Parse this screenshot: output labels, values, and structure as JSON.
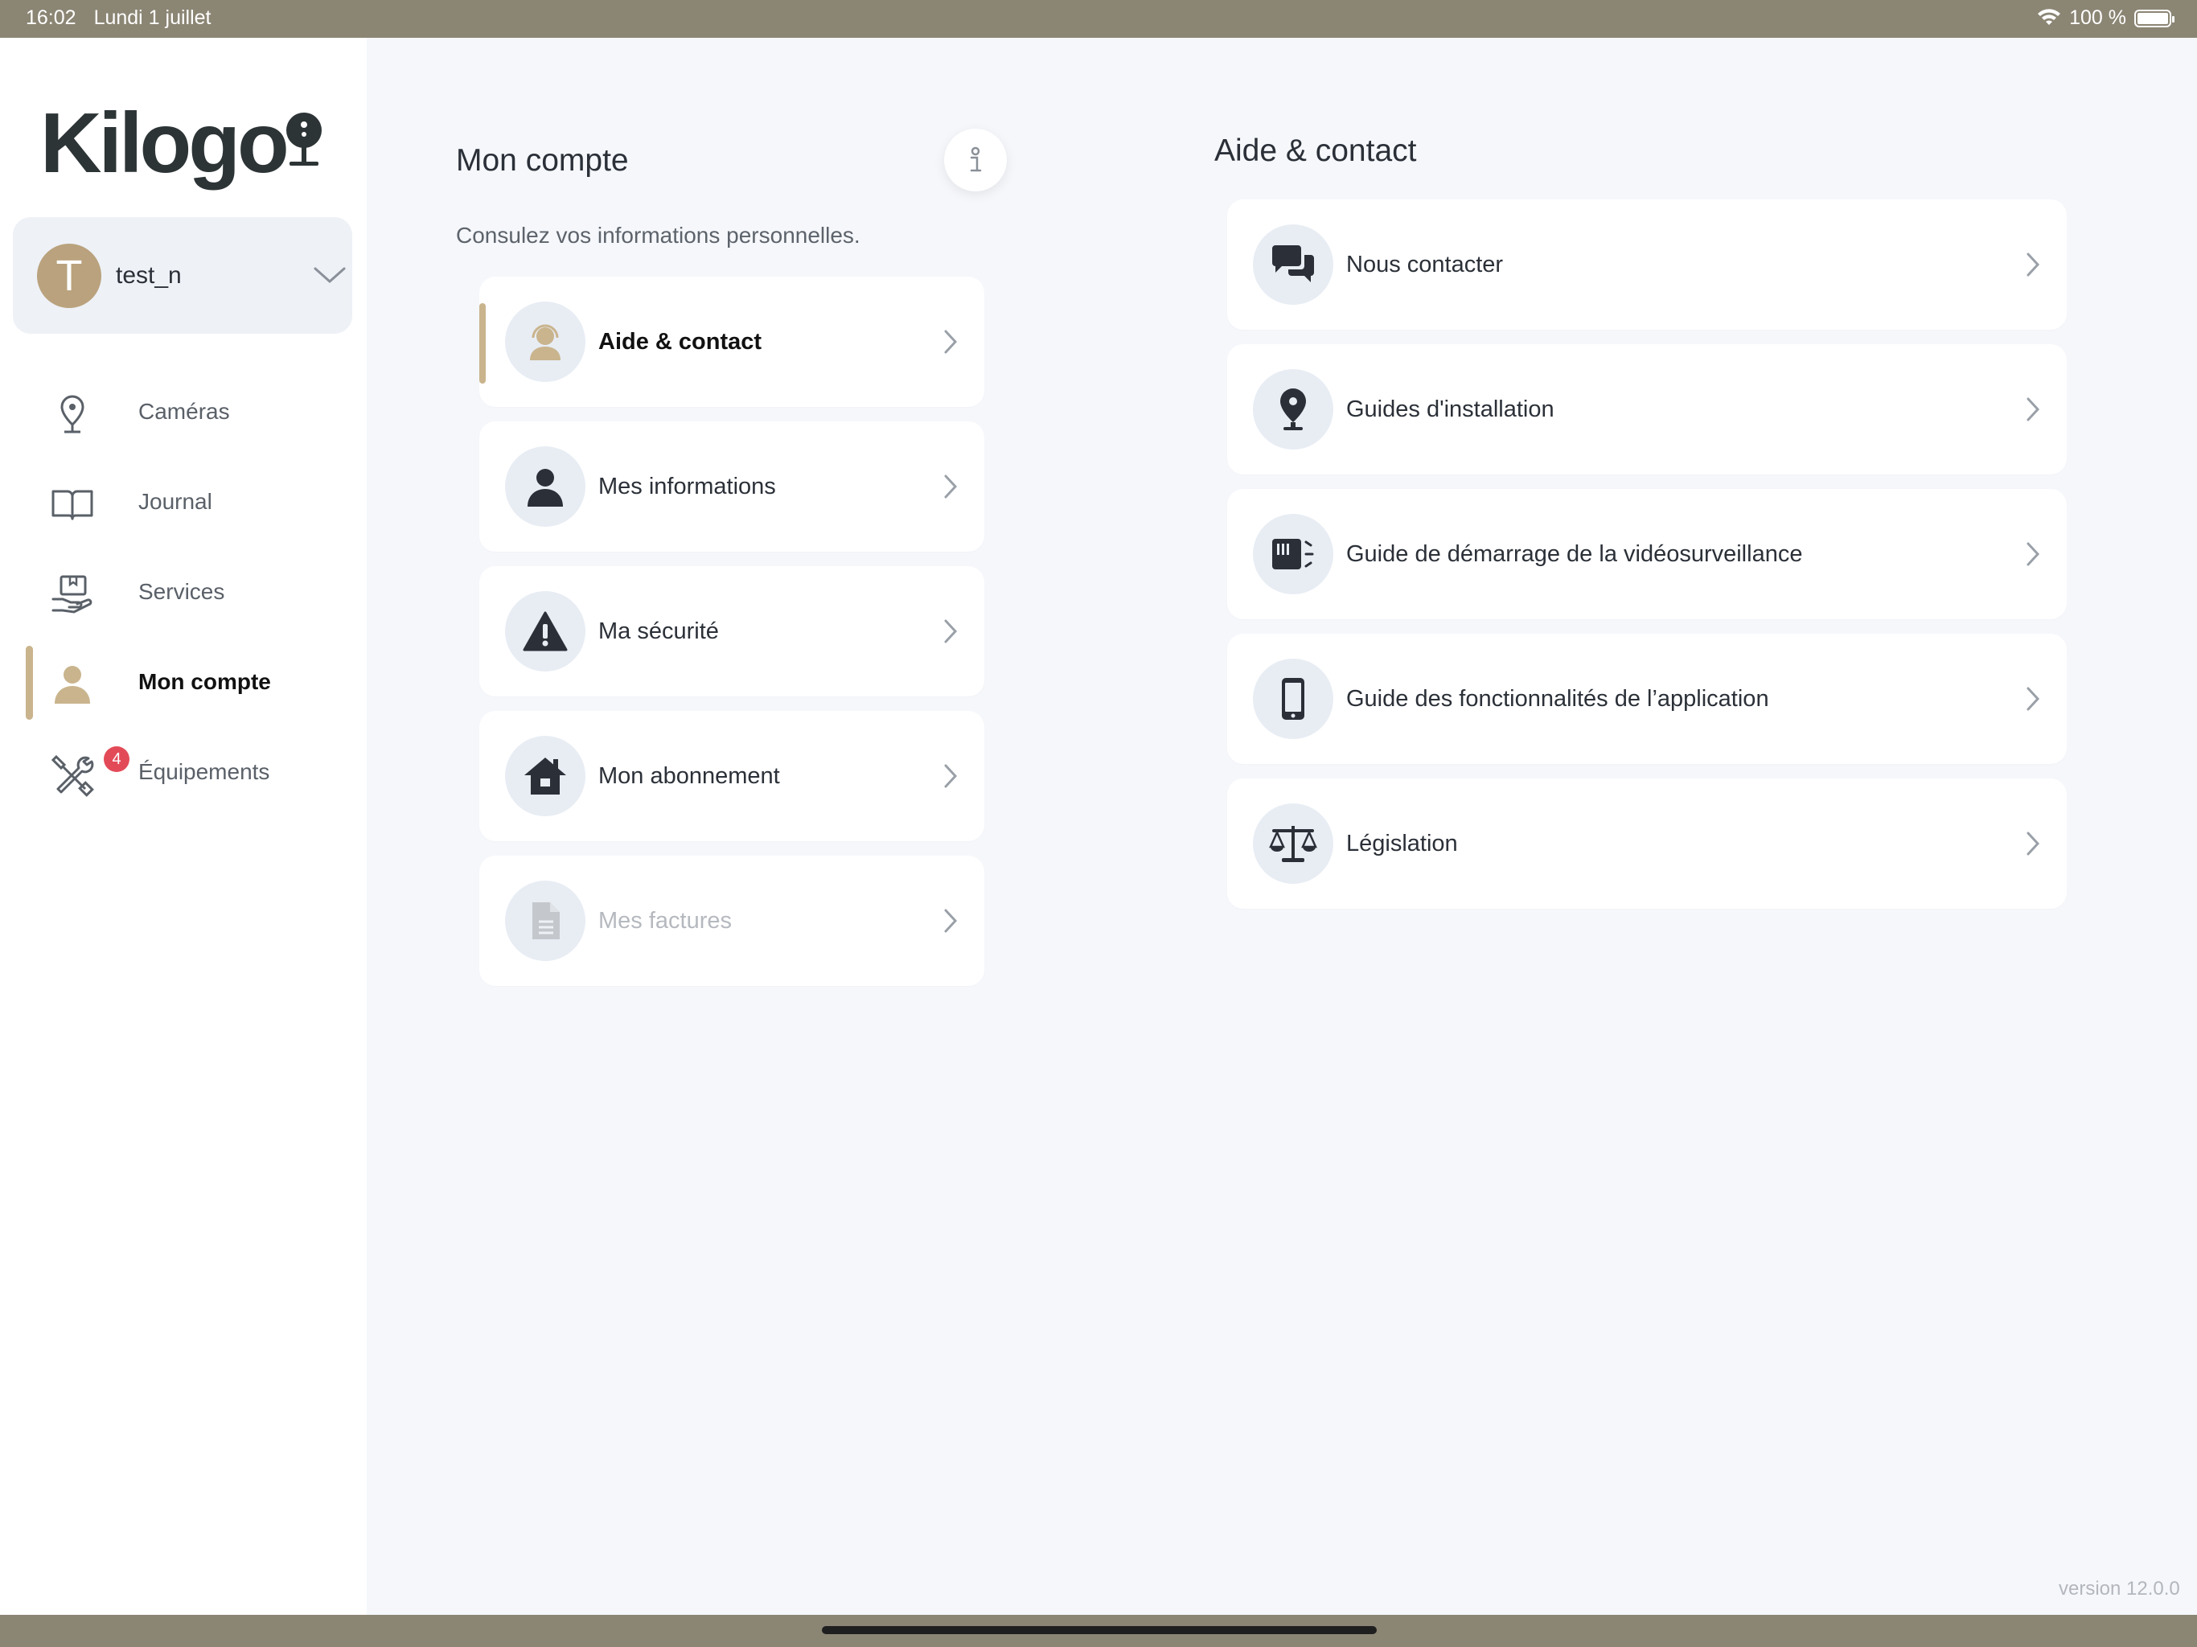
{
  "status_bar": {
    "time": "16:02",
    "date": "Lundi 1 juillet",
    "battery": "100 %"
  },
  "sidebar": {
    "logo": "Kilogo",
    "user": {
      "initial": "T",
      "name": "test_n"
    },
    "items": [
      {
        "label": "Caméras",
        "icon": "camera-pin-icon"
      },
      {
        "label": "Journal",
        "icon": "book-icon"
      },
      {
        "label": "Services",
        "icon": "services-hand-icon"
      },
      {
        "label": "Mon compte",
        "icon": "user-icon",
        "active": true
      },
      {
        "label": "Équipements",
        "icon": "tools-icon",
        "badge": "4"
      }
    ]
  },
  "account": {
    "title": "Mon compte",
    "subtitle": "Consulez vos informations personnelles.",
    "items": [
      {
        "label": "Aide & contact",
        "icon": "support-agent-icon",
        "active": true
      },
      {
        "label": "Mes informations",
        "icon": "person-icon"
      },
      {
        "label": "Ma sécurité",
        "icon": "warning-icon"
      },
      {
        "label": "Mon abonnement",
        "icon": "home-icon"
      },
      {
        "label": "Mes factures",
        "icon": "document-icon",
        "disabled": true
      }
    ]
  },
  "help": {
    "title": "Aide & contact",
    "items": [
      {
        "label": "Nous contacter",
        "icon": "chat-bubbles-icon"
      },
      {
        "label": "Guides d'installation",
        "icon": "location-pin-icon"
      },
      {
        "label": "Guide de démarrage de la vidéosurveillance",
        "icon": "camera-box-icon"
      },
      {
        "label": "Guide des fonctionnalités de l’application",
        "icon": "smartphone-icon"
      },
      {
        "label": "Législation",
        "icon": "scales-icon"
      }
    ]
  },
  "footer": {
    "version": "version 12.0.0"
  },
  "colors": {
    "accent": "#c9b48d",
    "avatar": "#b9a27d",
    "badge": "#e34a58",
    "status_bar": "#8b8574",
    "background": "#f5f7fb",
    "icon_circle": "#e8edf4"
  }
}
